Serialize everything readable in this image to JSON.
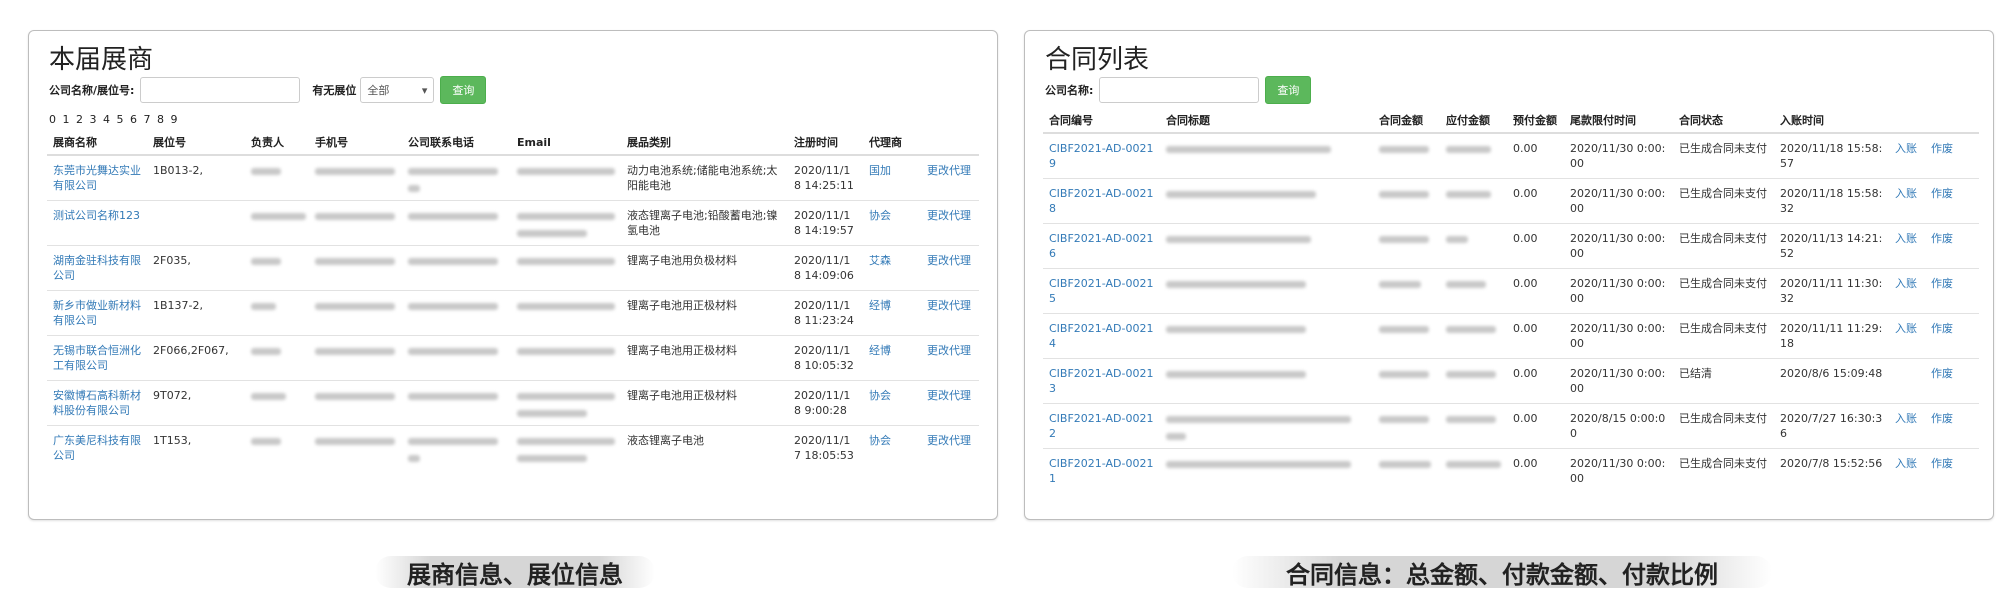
{
  "left_panel": {
    "title": "本届展商",
    "filter": {
      "company_label": "公司名称/展位号:",
      "company_value": "",
      "booth_label": "有无展位",
      "booth_select": "全部",
      "query_button": "查询"
    },
    "pager": "0 1 2 3 4 5 6 7 8 9",
    "columns": [
      "展商名称",
      "展位号",
      "负责人",
      "手机号",
      "公司联系电话",
      "Email",
      "展品类别",
      "注册时间",
      "代理商",
      ""
    ],
    "rows": [
      {
        "name": "东莞市光舞达实业有限公司",
        "booth": "1B013-2,",
        "category": "动力电池系统;储能电池系统;太阳能电池",
        "time": "2020/11/18 14:25:11",
        "agent": "国加",
        "action": "更改代理"
      },
      {
        "name": "测试公司名称123",
        "booth": "",
        "category": "液态锂离子电池;铅酸蓄电池;镍氢电池",
        "time": "2020/11/18 14:19:57",
        "agent": "协会",
        "action": "更改代理"
      },
      {
        "name": "湖南金驻科技有限公司",
        "booth": "2F035,",
        "category": "锂离子电池用负极材料",
        "time": "2020/11/18 14:09:06",
        "agent": "艾森",
        "action": "更改代理"
      },
      {
        "name": "新乡市做业新材料有限公司",
        "booth": "1B137-2,",
        "category": "锂离子电池用正极材料",
        "time": "2020/11/18 11:23:24",
        "agent": "经博",
        "action": "更改代理"
      },
      {
        "name": "无锡市联合恒洲化工有限公司",
        "booth": "2F066,2F067,",
        "category": "锂离子电池用正极材料",
        "time": "2020/11/18 10:05:32",
        "agent": "经博",
        "action": "更改代理"
      },
      {
        "name": "安徽博石高科新材料股份有限公司",
        "booth": "9T072,",
        "category": "锂离子电池用正极材料",
        "time": "2020/11/18 9:00:28",
        "agent": "协会",
        "action": "更改代理"
      },
      {
        "name": "广东美尼科技有限公司",
        "booth": "1T153,",
        "category": "液态锂离子电池",
        "time": "2020/11/17 18:05:53",
        "agent": "协会",
        "action": "更改代理"
      }
    ]
  },
  "right_panel": {
    "title": "合同列表",
    "filter": {
      "company_label": "公司名称:",
      "company_value": "",
      "query_button": "查询"
    },
    "columns": [
      "合同编号",
      "合同标题",
      "合同金额",
      "应付金额",
      "预付金额",
      "尾款限付时间",
      "合同状态",
      "入账时间",
      "",
      ""
    ],
    "rows": [
      {
        "id": "CIBF2021-AD-00219",
        "prepaid": "0.00",
        "deadline": "2020/11/30 0:00:00",
        "status": "已生成合同未支付",
        "time": "2020/11/18 15:58:57",
        "a1": "入账",
        "a2": "作废"
      },
      {
        "id": "CIBF2021-AD-00218",
        "prepaid": "0.00",
        "deadline": "2020/11/30 0:00:00",
        "status": "已生成合同未支付",
        "time": "2020/11/18 15:58:32",
        "a1": "入账",
        "a2": "作废"
      },
      {
        "id": "CIBF2021-AD-00216",
        "prepaid": "0.00",
        "deadline": "2020/11/30 0:00:00",
        "status": "已生成合同未支付",
        "time": "2020/11/13 14:21:52",
        "a1": "入账",
        "a2": "作废"
      },
      {
        "id": "CIBF2021-AD-00215",
        "prepaid": "0.00",
        "deadline": "2020/11/30 0:00:00",
        "status": "已生成合同未支付",
        "time": "2020/11/11 11:30:32",
        "a1": "入账",
        "a2": "作废"
      },
      {
        "id": "CIBF2021-AD-00214",
        "prepaid": "0.00",
        "deadline": "2020/11/30 0:00:00",
        "status": "已生成合同未支付",
        "time": "2020/11/11 11:29:18",
        "a1": "入账",
        "a2": "作废"
      },
      {
        "id": "CIBF2021-AD-00213",
        "prepaid": "0.00",
        "deadline": "2020/11/30 0:00:00",
        "status": "已结清",
        "time": "2020/8/6 15:09:48",
        "a1": "",
        "a2": "作废"
      },
      {
        "id": "CIBF2021-AD-00212",
        "prepaid": "0.00",
        "deadline": "2020/8/15 0:00:00",
        "status": "已生成合同未支付",
        "time": "2020/7/27 16:30:36",
        "a1": "入账",
        "a2": "作废"
      },
      {
        "id": "CIBF2021-AD-00211",
        "prepaid": "0.00",
        "deadline": "2020/11/30 0:00:00",
        "status": "已生成合同未支付",
        "time": "2020/7/8 15:52:56",
        "a1": "入账",
        "a2": "作废"
      }
    ]
  },
  "captions": {
    "left": "展商信息、展位信息",
    "right": "合同信息：总金额、付款金额、付款比例"
  },
  "colors": {
    "link": "#337ab7",
    "button": "#5cb85c",
    "border": "#bdbdbd"
  }
}
